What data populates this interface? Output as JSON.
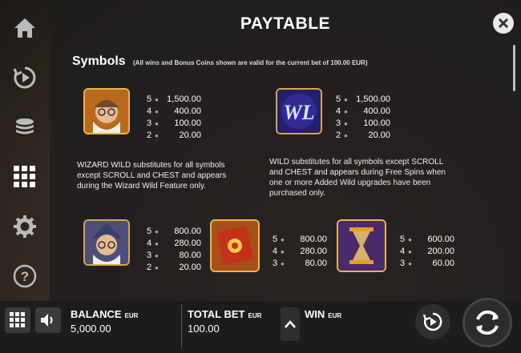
{
  "panel": {
    "title": "PAYTABLE",
    "symbols_heading": "Symbols",
    "symbols_note": "(All wins and Bonus Coins shown are valid for the current bet of 100.00 EUR)"
  },
  "sidebar": {
    "icons": [
      "home-icon",
      "autoplay-icon",
      "coins-icon",
      "paytable-grid-icon",
      "settings-gear-icon",
      "help-question-icon"
    ]
  },
  "symbols": [
    {
      "name": "wizard-wild",
      "pays": [
        {
          "k": "5",
          "v": "1,500.00"
        },
        {
          "k": "4",
          "v": "400.00"
        },
        {
          "k": "3",
          "v": "100.00"
        },
        {
          "k": "2",
          "v": "20.00"
        }
      ],
      "desc": "WIZARD WILD substitutes for all symbols except SCROLL and CHEST and appears during the Wizard Wild Feature only."
    },
    {
      "name": "wild",
      "pays": [
        {
          "k": "5",
          "v": "1,500.00"
        },
        {
          "k": "4",
          "v": "400.00"
        },
        {
          "k": "3",
          "v": "100.00"
        },
        {
          "k": "2",
          "v": "20.00"
        }
      ],
      "desc": "WILD substitutes for all symbols except SCROLL and CHEST and appears during Free Spins when one or more Added Wild upgrades have been purchased only."
    },
    {
      "name": "wizard",
      "pays": [
        {
          "k": "5",
          "v": "800.00"
        },
        {
          "k": "4",
          "v": "280.00"
        },
        {
          "k": "3",
          "v": "80.00"
        },
        {
          "k": "2",
          "v": "20.00"
        }
      ]
    },
    {
      "name": "spellbook",
      "pays": [
        {
          "k": "5",
          "v": "800.00"
        },
        {
          "k": "4",
          "v": "280.00"
        },
        {
          "k": "3",
          "v": "80.00"
        }
      ]
    },
    {
      "name": "hourglass",
      "pays": [
        {
          "k": "5",
          "v": "600.00"
        },
        {
          "k": "4",
          "v": "200.00"
        },
        {
          "k": "3",
          "v": "60.00"
        }
      ]
    }
  ],
  "bottom": {
    "balance_label": "BALANCE",
    "balance_currency": "EUR",
    "balance_value": "5,000.00",
    "bet_label": "TOTAL BET",
    "bet_currency": "EUR",
    "bet_value": "100.00",
    "win_label": "WIN",
    "win_currency": "EUR"
  },
  "colors": {
    "panel": "#201e1e",
    "bottom_bar": "#1c1c1c",
    "button": "#3a3a3a"
  }
}
